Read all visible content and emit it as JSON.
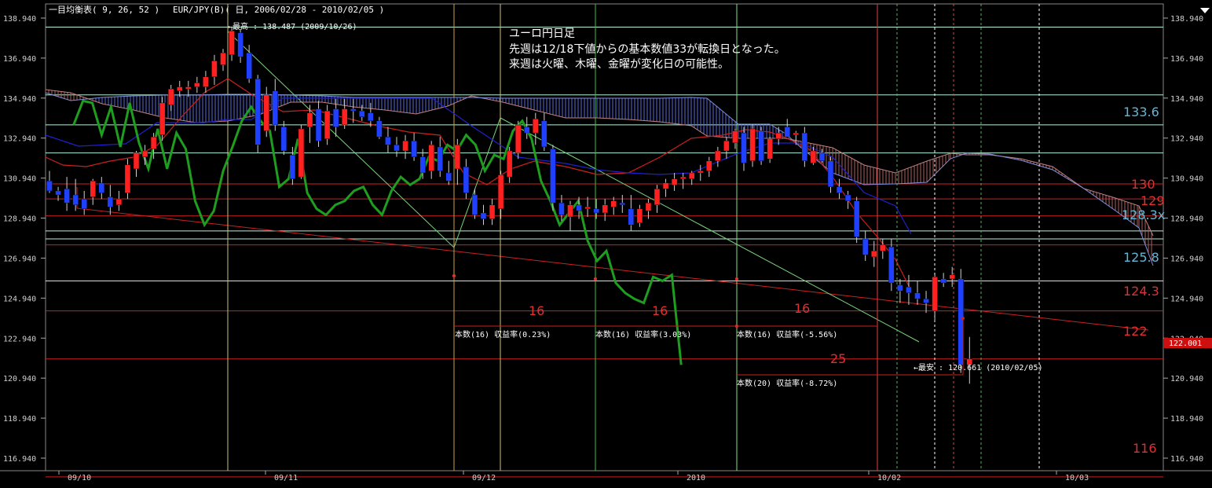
{
  "header": {
    "indicator": "一目均衡表( 9, 26, 52 )",
    "symbol_range": "EUR/JPY(B)( 日, 2006/02/28 - 2010/02/05 )"
  },
  "memo": {
    "lines": [
      "ユーロ円日足",
      "先週は12/18下値からの基本数値33が転換日となった。",
      "来週は火曜、木曜、金曜が変化日の可能性。"
    ]
  },
  "annotations": {
    "high_label": "←最高 : 138.487 (2009/10/26)",
    "low_label": "←最安 : 120.661 (2010/02/05)",
    "current_price": "122.001",
    "count_labels": [
      "16",
      "16",
      "16",
      "25"
    ],
    "stat_labels": [
      "本数(16) 収益率(0.23%)",
      "本数(16) 収益率(3.03%)",
      "本数(16) 収益率(-5.56%)",
      "本数(20) 収益率(-8.72%)"
    ]
  },
  "level_labels": {
    "red": [
      "130",
      "129",
      "124.3",
      "122",
      "116"
    ],
    "cyan": [
      "133.6",
      "128.3x",
      "125.8"
    ]
  },
  "colors": {
    "background": "#000000",
    "bull_candle": "#ff2020",
    "bear_candle": "#2040ff",
    "chikou": "#1e9e1e",
    "tenkan": "#cc2020",
    "kijun": "#2020cc",
    "red_level": "#cc2020",
    "cyan_level": "#b8f0d8",
    "price_tag": "#cc1010"
  },
  "chart_data": {
    "type": "candlestick",
    "title": "EUR/JPY(B) 日足 一目均衡表( 9, 26, 52 )",
    "x_tick_labels": [
      "09/10",
      "09/11",
      "09/12",
      "2010",
      "10/02",
      "10/03"
    ],
    "y_tick_labels": [
      "138.940",
      "136.940",
      "134.940",
      "132.940",
      "130.940",
      "128.940",
      "126.940",
      "124.940",
      "122.940",
      "120.940",
      "118.940",
      "116.940"
    ],
    "ylim": [
      115.6,
      140.0
    ],
    "red_horizontal_levels": [
      130.65,
      129.9,
      129.05,
      127.6,
      124.3,
      121.9,
      116.0
    ],
    "cyan_horizontal_levels": [
      138.487,
      135.1,
      133.6,
      132.2,
      128.3,
      127.9,
      125.8
    ],
    "ohlc": [
      [
        130.8,
        131.3,
        130.2,
        130.3
      ],
      [
        130.3,
        130.5,
        129.8,
        130.1
      ],
      [
        130.4,
        131.0,
        129.3,
        129.7
      ],
      [
        130.1,
        130.9,
        129.3,
        129.6
      ],
      [
        129.9,
        130.3,
        129.1,
        129.4
      ],
      [
        130.0,
        130.9,
        129.6,
        130.8
      ],
      [
        130.7,
        131.0,
        129.9,
        130.2
      ],
      [
        130.0,
        130.6,
        129.1,
        129.5
      ],
      [
        129.6,
        130.3,
        129.3,
        129.9
      ],
      [
        130.2,
        131.9,
        129.9,
        131.6
      ],
      [
        131.4,
        132.3,
        131.0,
        132.2
      ],
      [
        132.0,
        132.6,
        131.6,
        132.3
      ],
      [
        132.4,
        133.2,
        131.9,
        133.0
      ],
      [
        133.1,
        135.0,
        132.8,
        134.7
      ],
      [
        134.6,
        135.6,
        134.3,
        135.4
      ],
      [
        135.3,
        135.8,
        135.0,
        135.5
      ],
      [
        135.4,
        135.8,
        135.0,
        135.5
      ],
      [
        135.5,
        136.0,
        135.2,
        135.7
      ],
      [
        135.5,
        136.3,
        135.2,
        136.0
      ],
      [
        136.0,
        137.1,
        135.6,
        136.8
      ],
      [
        136.6,
        137.4,
        136.3,
        137.2
      ],
      [
        137.1,
        138.5,
        136.8,
        138.3
      ],
      [
        138.2,
        138.4,
        136.7,
        137.0
      ],
      [
        137.2,
        137.6,
        135.7,
        135.9
      ],
      [
        135.9,
        136.1,
        132.2,
        132.6
      ],
      [
        133.3,
        135.5,
        133.0,
        135.1
      ],
      [
        135.3,
        135.9,
        133.3,
        133.6
      ],
      [
        133.5,
        133.8,
        132.1,
        132.3
      ],
      [
        132.1,
        132.5,
        130.6,
        130.9
      ],
      [
        131.0,
        133.6,
        130.9,
        133.4
      ],
      [
        133.5,
        134.6,
        132.7,
        134.2
      ],
      [
        134.4,
        134.8,
        132.5,
        132.8
      ],
      [
        132.9,
        134.6,
        132.6,
        134.3
      ],
      [
        134.4,
        134.9,
        133.0,
        133.5
      ],
      [
        133.6,
        134.9,
        133.4,
        134.4
      ],
      [
        134.4,
        134.9,
        133.7,
        134.3
      ],
      [
        134.3,
        134.6,
        133.8,
        134.0
      ],
      [
        134.2,
        134.7,
        133.5,
        133.8
      ],
      [
        133.8,
        134.0,
        132.9,
        133.0
      ],
      [
        133.0,
        133.5,
        132.2,
        132.6
      ],
      [
        132.6,
        133.0,
        132.0,
        132.3
      ],
      [
        132.3,
        133.1,
        131.9,
        132.8
      ],
      [
        132.8,
        133.2,
        131.8,
        132.0
      ],
      [
        132.0,
        132.4,
        130.9,
        131.2
      ],
      [
        131.3,
        132.8,
        130.9,
        132.6
      ],
      [
        132.5,
        133.0,
        131.0,
        131.3
      ],
      [
        131.2,
        131.8,
        130.6,
        130.8
      ],
      [
        131.4,
        132.9,
        130.6,
        132.6
      ],
      [
        131.5,
        131.9,
        129.9,
        130.2
      ],
      [
        130.1,
        130.4,
        128.9,
        129.1
      ],
      [
        129.2,
        129.6,
        128.6,
        128.9
      ],
      [
        128.9,
        129.9,
        128.6,
        129.6
      ],
      [
        129.4,
        131.3,
        128.9,
        131.1
      ],
      [
        131.0,
        132.5,
        130.7,
        132.3
      ],
      [
        132.2,
        133.8,
        131.9,
        133.6
      ],
      [
        133.5,
        134.0,
        132.9,
        133.2
      ],
      [
        133.2,
        134.2,
        132.6,
        133.9
      ],
      [
        133.8,
        134.2,
        132.3,
        132.5
      ],
      [
        132.4,
        132.6,
        129.3,
        129.7
      ],
      [
        129.7,
        130.1,
        128.8,
        129.1
      ],
      [
        129.0,
        129.8,
        128.3,
        129.6
      ],
      [
        129.6,
        130.0,
        128.9,
        129.3
      ],
      [
        129.4,
        130.0,
        129.0,
        129.5
      ],
      [
        129.4,
        129.9,
        128.9,
        129.2
      ],
      [
        129.2,
        129.9,
        128.8,
        129.6
      ],
      [
        129.5,
        130.0,
        129.1,
        129.8
      ],
      [
        129.7,
        130.1,
        129.2,
        129.6
      ],
      [
        129.4,
        130.1,
        128.3,
        128.6
      ],
      [
        128.7,
        129.6,
        128.5,
        129.4
      ],
      [
        129.3,
        129.9,
        128.9,
        129.7
      ],
      [
        129.6,
        130.6,
        129.2,
        130.4
      ],
      [
        130.4,
        130.9,
        130.0,
        130.7
      ],
      [
        130.6,
        131.2,
        130.3,
        130.9
      ],
      [
        130.9,
        131.2,
        130.4,
        131.0
      ],
      [
        130.9,
        131.3,
        130.6,
        131.2
      ],
      [
        131.2,
        131.6,
        130.8,
        131.3
      ],
      [
        131.3,
        132.0,
        131.0,
        131.8
      ],
      [
        131.8,
        132.5,
        131.5,
        132.3
      ],
      [
        132.3,
        133.0,
        131.9,
        132.8
      ],
      [
        132.7,
        133.4,
        132.4,
        133.3
      ],
      [
        133.2,
        133.5,
        131.3,
        131.7
      ],
      [
        131.8,
        133.6,
        131.5,
        133.4
      ],
      [
        133.3,
        133.5,
        131.6,
        131.8
      ],
      [
        131.9,
        133.0,
        131.7,
        132.9
      ],
      [
        132.9,
        133.5,
        132.6,
        133.2
      ],
      [
        133.5,
        133.9,
        133.1,
        133.0
      ],
      [
        133.1,
        133.3,
        132.6,
        133.2
      ],
      [
        133.2,
        133.5,
        131.5,
        131.8
      ],
      [
        131.7,
        132.5,
        131.6,
        132.3
      ],
      [
        132.2,
        132.4,
        131.7,
        131.8
      ],
      [
        131.8,
        132.0,
        130.2,
        130.5
      ],
      [
        130.5,
        130.9,
        129.9,
        130.2
      ],
      [
        130.1,
        130.3,
        129.4,
        129.8
      ],
      [
        129.8,
        130.0,
        127.7,
        128.0
      ],
      [
        127.9,
        128.3,
        126.8,
        127.1
      ],
      [
        127.0,
        127.8,
        126.5,
        127.3
      ],
      [
        127.3,
        127.9,
        126.9,
        127.6
      ],
      [
        127.5,
        127.9,
        125.3,
        125.7
      ],
      [
        125.6,
        125.9,
        124.7,
        125.3
      ],
      [
        125.5,
        126.1,
        124.6,
        125.2
      ],
      [
        125.2,
        125.8,
        124.6,
        124.9
      ],
      [
        124.9,
        125.3,
        124.2,
        124.7
      ],
      [
        124.3,
        126.1,
        123.8,
        126.0
      ],
      [
        125.9,
        126.2,
        125.5,
        125.7
      ],
      [
        125.9,
        126.5,
        125.5,
        126.1
      ],
      [
        125.9,
        126.4,
        121.2,
        121.6
      ],
      [
        121.6,
        123.0,
        120.66,
        121.9
      ]
    ],
    "chikou": [
      [
        133.6,
        15
      ],
      [
        134.8,
        20
      ],
      [
        134.7,
        25
      ],
      [
        133.1,
        30
      ],
      [
        134.5,
        35
      ],
      [
        132.5,
        40
      ],
      [
        134.7,
        45
      ],
      [
        132.7,
        50
      ],
      [
        131.4,
        55
      ],
      [
        133.4,
        60
      ],
      [
        131.4,
        65
      ],
      [
        133.2,
        70
      ],
      [
        132.4,
        75
      ],
      [
        129.8,
        80
      ],
      [
        128.6,
        85
      ],
      [
        129.3,
        90
      ],
      [
        131.3,
        95
      ],
      [
        132.5,
        100
      ],
      [
        133.8,
        105
      ],
      [
        134.5,
        110
      ],
      [
        133.8,
        115
      ],
      [
        133.3,
        120
      ],
      [
        130.5,
        125
      ],
      [
        130.9,
        130
      ],
      [
        132.9,
        135
      ],
      [
        130.2,
        140
      ],
      [
        129.4,
        145
      ],
      [
        129.1,
        150
      ],
      [
        129.6,
        155
      ],
      [
        129.8,
        160
      ],
      [
        130.3,
        165
      ],
      [
        130.5,
        170
      ],
      [
        129.6,
        175
      ],
      [
        129.1,
        180
      ],
      [
        130.3,
        185
      ],
      [
        131.0,
        190
      ],
      [
        130.6,
        195
      ],
      [
        130.9,
        200
      ],
      [
        132.0,
        205
      ],
      [
        131.8,
        210
      ],
      [
        132.6,
        215
      ],
      [
        132.3,
        220
      ],
      [
        133.1,
        225
      ],
      [
        132.6,
        230
      ],
      [
        131.3,
        235
      ],
      [
        132.1,
        240
      ],
      [
        131.9,
        245
      ],
      [
        133.3,
        250
      ],
      [
        133.8,
        255
      ],
      [
        132.9,
        260
      ],
      [
        130.8,
        265
      ],
      [
        129.8,
        270
      ],
      [
        128.6,
        275
      ],
      [
        129.2,
        280
      ],
      [
        129.8,
        285
      ],
      [
        127.8,
        290
      ],
      [
        126.8,
        295
      ],
      [
        127.3,
        300
      ],
      [
        125.7,
        305
      ],
      [
        125.2,
        310
      ],
      [
        124.9,
        315
      ],
      [
        124.7,
        320
      ],
      [
        126.0,
        325
      ],
      [
        125.8,
        330
      ],
      [
        126.1,
        335
      ],
      [
        121.6,
        340
      ]
    ]
  }
}
